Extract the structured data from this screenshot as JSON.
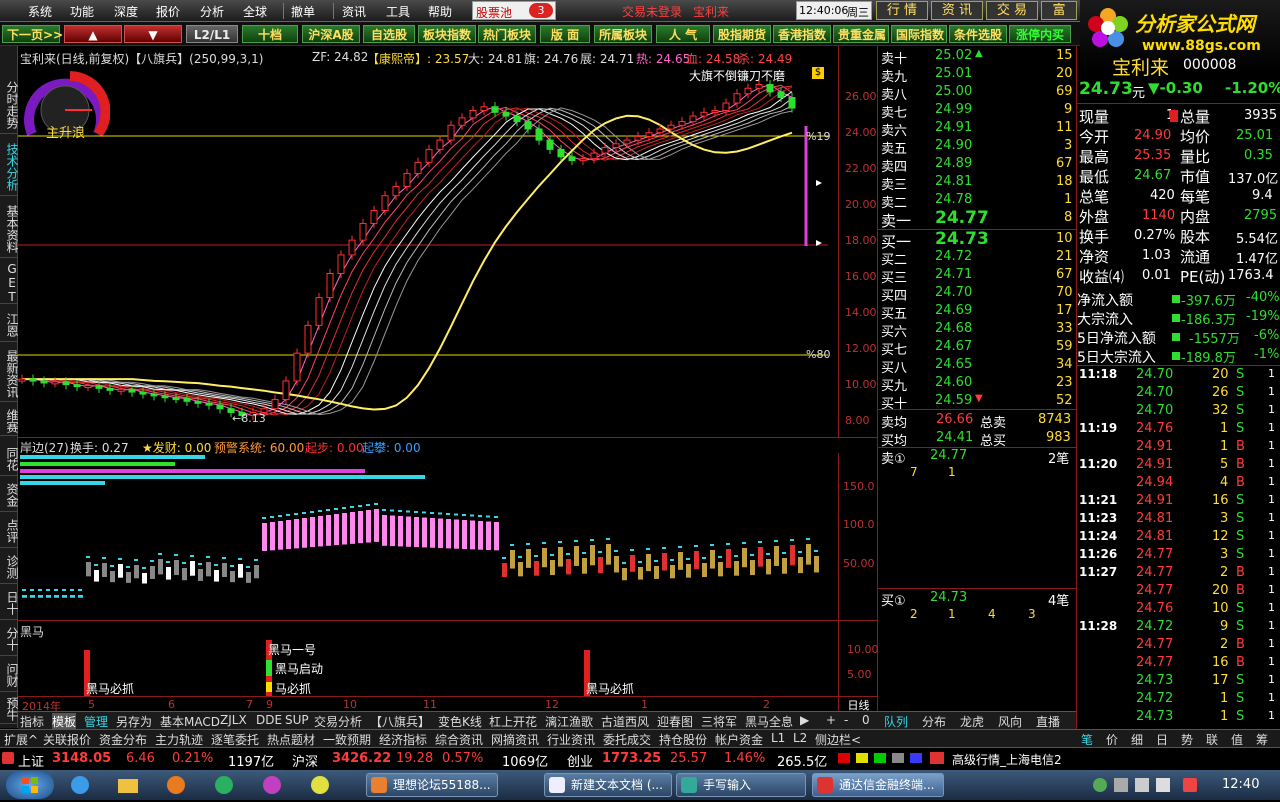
{
  "menu": {
    "items": [
      "系统",
      "功能",
      "深度",
      "报价",
      "分析",
      "全球",
      "撤单",
      "资讯",
      "工具",
      "帮助"
    ],
    "stock_pool": "股票池",
    "stock_pool_badge": "3",
    "trade_status": "交易未登录",
    "stock_name": "宝利来",
    "time": "12:40:06",
    "weekday": "周三",
    "right_buttons": [
      "行 情",
      "资 讯",
      "交 易",
      "富"
    ]
  },
  "brand": {
    "title": "分析家公式网",
    "url": "www.88gs.com"
  },
  "toolbar": {
    "buttons": [
      "下一页>>",
      "▲",
      "▼",
      "L2/L1",
      "十档",
      "沪深A股",
      "自选股",
      "板块指数",
      "热门板块",
      "版 面",
      "所属板块",
      "人 气",
      "股指期货",
      "香港指数",
      "贵重金属",
      "国际指数",
      "条件选股",
      "涨停内买"
    ]
  },
  "vtabs": [
    "分时走势",
    "技术分析",
    "基本资料",
    "GET",
    "江恩",
    "最新资讯",
    "维赛"
  ],
  "vtabs2": [
    "同花",
    "资金",
    "点评",
    "诊测",
    "日十",
    "分十",
    "问财",
    "预牛"
  ],
  "main_chart": {
    "title": "宝利来(日线,前复权)【八旗兵】(250,99,3,1)",
    "zf": "ZF: 24.82",
    "kangxi": "【康熙帝】: 23.57",
    "da": "大: 24.81",
    "qi": "旗: 24.76",
    "zhan": "展: 24.71",
    "re": "热: 24.65",
    "xue": "血: 24.58",
    "sha": "杀: 24.49",
    "signal": "大旗不倒镰刀不磨",
    "price_label": "$",
    "low_label": "8.13",
    "badge_label": "主升浪",
    "pct_top": "%19",
    "pct_bottom": "%80",
    "y_axis": [
      "26.00",
      "24.00",
      "22.00",
      "20.00",
      "18.00",
      "16.00",
      "14.00",
      "12.00",
      "10.00",
      "8.00"
    ]
  },
  "sub_chart1": {
    "title": "岸边(27)",
    "turnover": "换手: 0.27",
    "fa_cai": "★发财: 0.00",
    "warn": "预警系统: 60.00",
    "qi_bu": "起步: 0.00",
    "qi_pan": "起攀: 0.00",
    "y_axis": [
      "150.0",
      "100.0",
      "50.00"
    ]
  },
  "sub_chart2": {
    "title": "黑马",
    "labels": [
      "黑马必抓",
      "黑马一号",
      "黑马启动",
      "马必抓",
      "黑马必抓"
    ],
    "y_axis": [
      "10.00",
      "5.00"
    ]
  },
  "x_axis": {
    "year": "2014年",
    "months": [
      "5",
      "6",
      "7",
      "8",
      "9",
      "10",
      "11",
      "12",
      "1",
      "2"
    ],
    "unit": "日线"
  },
  "chart_data": {
    "type": "candlestick",
    "title": "宝利来(日线,前复权)",
    "ylim": [
      8,
      27
    ],
    "closes": [
      10.1,
      10.0,
      9.9,
      9.95,
      9.8,
      9.7,
      9.75,
      9.6,
      9.5,
      9.55,
      9.4,
      9.3,
      9.2,
      9.1,
      9.05,
      8.9,
      8.8,
      8.7,
      8.5,
      8.3,
      8.13,
      8.3,
      8.5,
      9.0,
      10.0,
      11.5,
      13.0,
      14.5,
      15.8,
      16.8,
      17.6,
      18.5,
      19.2,
      20.0,
      20.5,
      21.2,
      21.8,
      22.5,
      23.0,
      23.8,
      24.2,
      24.6,
      24.8,
      24.5,
      24.3,
      24.0,
      23.6,
      23.0,
      22.5,
      22.1,
      21.9,
      22.0,
      22.3,
      22.6,
      22.8,
      23.0,
      23.2,
      23.4,
      23.6,
      23.8,
      24.0,
      24.3,
      24.5,
      24.6,
      25.0,
      25.5,
      25.8,
      26.0,
      25.6,
      25.3,
      24.73
    ],
    "ma_series": "八旗兵"
  },
  "quote": {
    "name": "宝利来",
    "code": "000008",
    "price": "24.73",
    "unit": "元",
    "change": "▼-0.30",
    "pct": "-1.20%",
    "sells": [
      {
        "label": "卖十",
        "price": "25.02",
        "vol": "15",
        "mark": "▲"
      },
      {
        "label": "卖九",
        "price": "25.01",
        "vol": "20",
        "mark": ""
      },
      {
        "label": "卖八",
        "price": "25.00",
        "vol": "69",
        "mark": ""
      },
      {
        "label": "卖七",
        "price": "24.99",
        "vol": "9",
        "mark": ""
      },
      {
        "label": "卖六",
        "price": "24.91",
        "vol": "11",
        "mark": ""
      },
      {
        "label": "卖五",
        "price": "24.90",
        "vol": "3",
        "mark": ""
      },
      {
        "label": "卖四",
        "price": "24.89",
        "vol": "67",
        "mark": ""
      },
      {
        "label": "卖三",
        "price": "24.81",
        "vol": "18",
        "mark": ""
      },
      {
        "label": "卖二",
        "price": "24.78",
        "vol": "1",
        "mark": ""
      },
      {
        "label": "卖一",
        "price": "24.77",
        "vol": "8",
        "mark": ""
      }
    ],
    "buys": [
      {
        "label": "买一",
        "price": "24.73",
        "vol": "10",
        "mark": ""
      },
      {
        "label": "买二",
        "price": "24.72",
        "vol": "21",
        "mark": ""
      },
      {
        "label": "买三",
        "price": "24.71",
        "vol": "67",
        "mark": ""
      },
      {
        "label": "买四",
        "price": "24.70",
        "vol": "70",
        "mark": ""
      },
      {
        "label": "买五",
        "price": "24.69",
        "vol": "17",
        "mark": ""
      },
      {
        "label": "买六",
        "price": "24.68",
        "vol": "33",
        "mark": ""
      },
      {
        "label": "买七",
        "price": "24.67",
        "vol": "59",
        "mark": ""
      },
      {
        "label": "买八",
        "price": "24.65",
        "vol": "34",
        "mark": ""
      },
      {
        "label": "买九",
        "price": "24.60",
        "vol": "23",
        "mark": ""
      },
      {
        "label": "买十",
        "price": "24.59",
        "vol": "52",
        "mark": "▼"
      }
    ],
    "sell_avg": {
      "label": "卖均",
      "price": "26.66",
      "total_label": "总卖",
      "total": "8743"
    },
    "buy_avg": {
      "label": "买均",
      "price": "24.41",
      "total_label": "总买",
      "total": "983"
    },
    "queue_sell": {
      "label": "卖①",
      "price": "24.77",
      "count": "2笔",
      "orders": [
        "7",
        "1"
      ]
    },
    "queue_buy": {
      "label": "买①",
      "price": "24.73",
      "count": "4笔",
      "orders": [
        "2",
        "1",
        "4",
        "3"
      ]
    },
    "stats": [
      {
        "k1": "现量",
        "v1": "1",
        "k2": "总量",
        "v2": "3935"
      },
      {
        "k1": "今开",
        "v1": "24.90",
        "k2": "均价",
        "v2": "25.01"
      },
      {
        "k1": "最高",
        "v1": "25.35",
        "k2": "量比",
        "v2": "0.35"
      },
      {
        "k1": "最低",
        "v1": "24.67",
        "k2": "市值",
        "v2": "137.0亿"
      },
      {
        "k1": "总笔",
        "v1": "420",
        "k2": "每笔",
        "v2": "9.4"
      },
      {
        "k1": "外盘",
        "v1": "1140",
        "k2": "内盘",
        "v2": "2795"
      },
      {
        "k1": "换手",
        "v1": "0.27%",
        "k2": "股本",
        "v2": "5.54亿"
      },
      {
        "k1": "净资",
        "v1": "1.03",
        "k2": "流通",
        "v2": "1.47亿"
      },
      {
        "k1": "收益⑷",
        "v1": "0.01",
        "k2": "PE(动)",
        "v2": "1763.4"
      }
    ],
    "flows": [
      {
        "k": "净流入额",
        "v": "-397.6万",
        "p": "-40%"
      },
      {
        "k": "大宗流入",
        "v": "-186.3万",
        "p": "-19%"
      },
      {
        "k": "5日净流入额",
        "v": "-1557万",
        "p": "-6%"
      },
      {
        "k": "5日大宗流入",
        "v": "-189.8万",
        "p": "-1%"
      }
    ],
    "ticks": [
      {
        "t": "11:18",
        "p": "24.70",
        "v": "20",
        "s": "S"
      },
      {
        "t": "",
        "p": "24.70",
        "v": "26",
        "s": "S"
      },
      {
        "t": "",
        "p": "24.70",
        "v": "32",
        "s": "S"
      },
      {
        "t": "11:19",
        "p": "24.76",
        "v": "1",
        "s": "S"
      },
      {
        "t": "",
        "p": "24.91",
        "v": "1",
        "s": "B"
      },
      {
        "t": "11:20",
        "p": "24.91",
        "v": "5",
        "s": "B"
      },
      {
        "t": "",
        "p": "24.94",
        "v": "4",
        "s": "B"
      },
      {
        "t": "11:21",
        "p": "24.91",
        "v": "16",
        "s": "S"
      },
      {
        "t": "11:23",
        "p": "24.81",
        "v": "3",
        "s": "S"
      },
      {
        "t": "11:24",
        "p": "24.81",
        "v": "12",
        "s": "S"
      },
      {
        "t": "11:26",
        "p": "24.77",
        "v": "3",
        "s": "S"
      },
      {
        "t": "11:27",
        "p": "24.77",
        "v": "2",
        "s": "B"
      },
      {
        "t": "",
        "p": "24.77",
        "v": "20",
        "s": "B"
      },
      {
        "t": "",
        "p": "24.76",
        "v": "10",
        "s": "S"
      },
      {
        "t": "11:28",
        "p": "24.72",
        "v": "9",
        "s": "S"
      },
      {
        "t": "",
        "p": "24.77",
        "v": "2",
        "s": "B"
      },
      {
        "t": "",
        "p": "24.77",
        "v": "16",
        "s": "B"
      },
      {
        "t": "",
        "p": "24.73",
        "v": "17",
        "s": "S"
      },
      {
        "t": "",
        "p": "24.72",
        "v": "1",
        "s": "S"
      },
      {
        "t": "",
        "p": "24.73",
        "v": "1",
        "s": "S"
      }
    ]
  },
  "bottom_tabs1": [
    "指标",
    "模板",
    "管理",
    "另存为",
    "基本MACD",
    "ZJLX",
    "DDE",
    "SUP",
    "交易分析",
    "【八旗兵】",
    "变色K线",
    "杠上开花",
    "漓江渔歌",
    "古道西风",
    "迎春图",
    "三将军",
    "黑马全息"
  ],
  "bottom_tabs1_right": [
    "+",
    "-",
    "0"
  ],
  "bottom_tabs2": [
    "扩展^",
    "关联报价",
    "资金分布",
    "主力轨迹",
    "逐笔委托",
    "热点题材",
    "一致预期",
    "经济指标",
    "综合资讯",
    "网摘资讯",
    "行业资讯",
    "委托成交",
    "持仓股份",
    "帐户资金",
    "L1",
    "L2",
    "侧边栏<"
  ],
  "right_tabs": [
    "队列",
    "分布",
    "龙虎",
    "风向",
    "直播"
  ],
  "right_tabs2": [
    "笔",
    "价",
    "细",
    "日",
    "势",
    "联",
    "值",
    "筹"
  ],
  "ticker": {
    "sh_name": "上证",
    "sh_val": "3148.05",
    "sh_chg": "6.46",
    "sh_pct": "0.21%",
    "sh_amt": "1197亿",
    "hs_name": "沪深",
    "hs_val": "3426.22",
    "hs_chg": "19.28",
    "hs_pct": "0.57%",
    "hs_amt": "1069亿",
    "cy_name": "创业",
    "cy_val": "1773.25",
    "cy_chg": "25.57",
    "cy_pct": "1.46%",
    "cy_amt": "265.5亿",
    "server": "高级行情_上海电信2"
  },
  "taskbar": {
    "tasks": [
      "理想论坛55188...",
      "新建文本文档 (...",
      "手写输入",
      "通达信金融终端..."
    ],
    "clock": "12:40"
  }
}
